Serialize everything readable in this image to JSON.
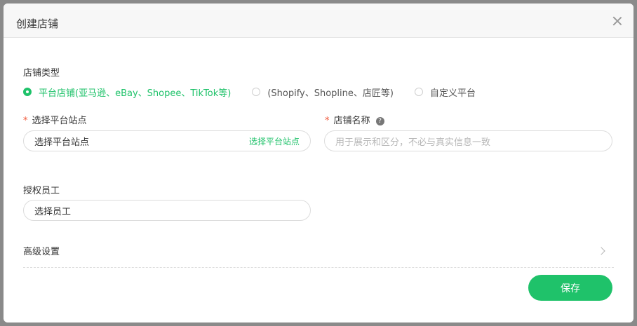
{
  "dialog": {
    "title": "创建店铺"
  },
  "store_type": {
    "label": "店铺类型",
    "options": [
      {
        "label": "平台店铺(亚马逊、eBay、Shopee、TikTok等)",
        "selected": true
      },
      {
        "label": "(Shopify、Shopline、店匠等)",
        "selected": false
      },
      {
        "label": "自定义平台",
        "selected": false
      }
    ]
  },
  "site": {
    "label": "选择平台站点",
    "value": "选择平台站点",
    "action": "选择平台站点"
  },
  "store_name": {
    "label": "店铺名称",
    "help": "?",
    "placeholder": "用于展示和区分，不必与真实信息一致"
  },
  "employees": {
    "label": "授权员工",
    "value": "选择员工"
  },
  "advanced": {
    "label": "高级设置"
  },
  "footer": {
    "save_label": "保存"
  },
  "colors": {
    "accent": "#1fc26a",
    "required": "#f05a3c"
  }
}
